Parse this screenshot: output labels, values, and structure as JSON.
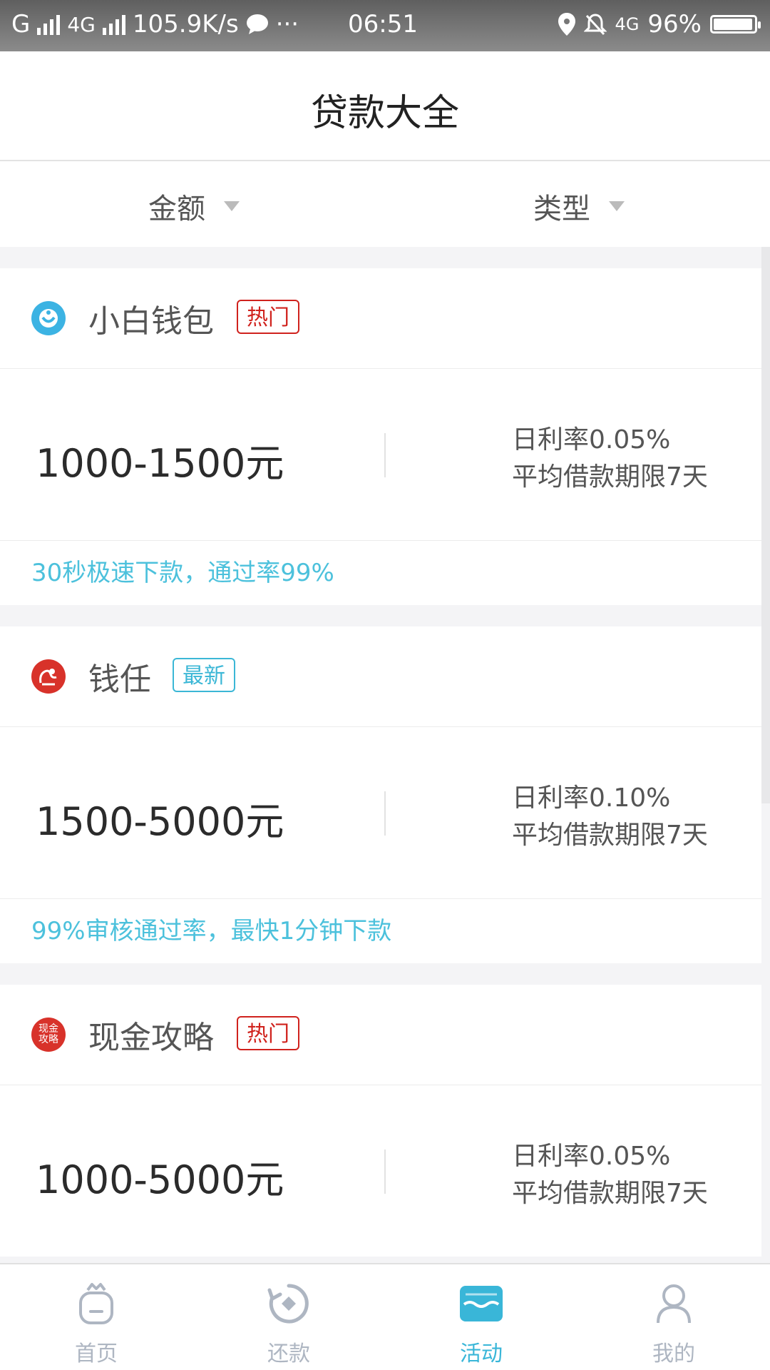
{
  "status_bar": {
    "carrier": "G",
    "network": "4G",
    "speed": "105.9K/s",
    "dots": "···",
    "time": "06:51",
    "net2": "4G",
    "battery": "96%",
    "battery_level": 0.96
  },
  "header": {
    "title": "贷款大全"
  },
  "filters": [
    {
      "label": "金额"
    },
    {
      "label": "类型"
    }
  ],
  "cards": [
    {
      "name": "小白钱包",
      "tag": "热门",
      "amount": "1000-1500元",
      "rate": "日利率0.05%",
      "term": "平均借款期限7天",
      "slogan": "30秒极速下款，通过率99%"
    },
    {
      "name": "钱任",
      "tag": "最新",
      "amount": "1500-5000元",
      "rate": "日利率0.10%",
      "term": "平均借款期限7天",
      "slogan": "99%审核通过率，最快1分钟下款"
    },
    {
      "name": "现金攻略",
      "logo_text": "现金攻略",
      "tag": "热门",
      "amount": "1000-5000元",
      "rate": "日利率0.05%",
      "term": "平均借款期限7天"
    }
  ],
  "colors": {
    "accent": "#39b6d8",
    "hot": "#d0221d",
    "new": "#3bb7d6",
    "inactive": "#aeb6c2"
  },
  "tabs": [
    {
      "label": "首页",
      "icon": "bag-icon"
    },
    {
      "label": "还款",
      "icon": "repay-icon"
    },
    {
      "label": "活动",
      "icon": "shop-icon",
      "active": true
    },
    {
      "label": "我的",
      "icon": "person-icon"
    }
  ]
}
